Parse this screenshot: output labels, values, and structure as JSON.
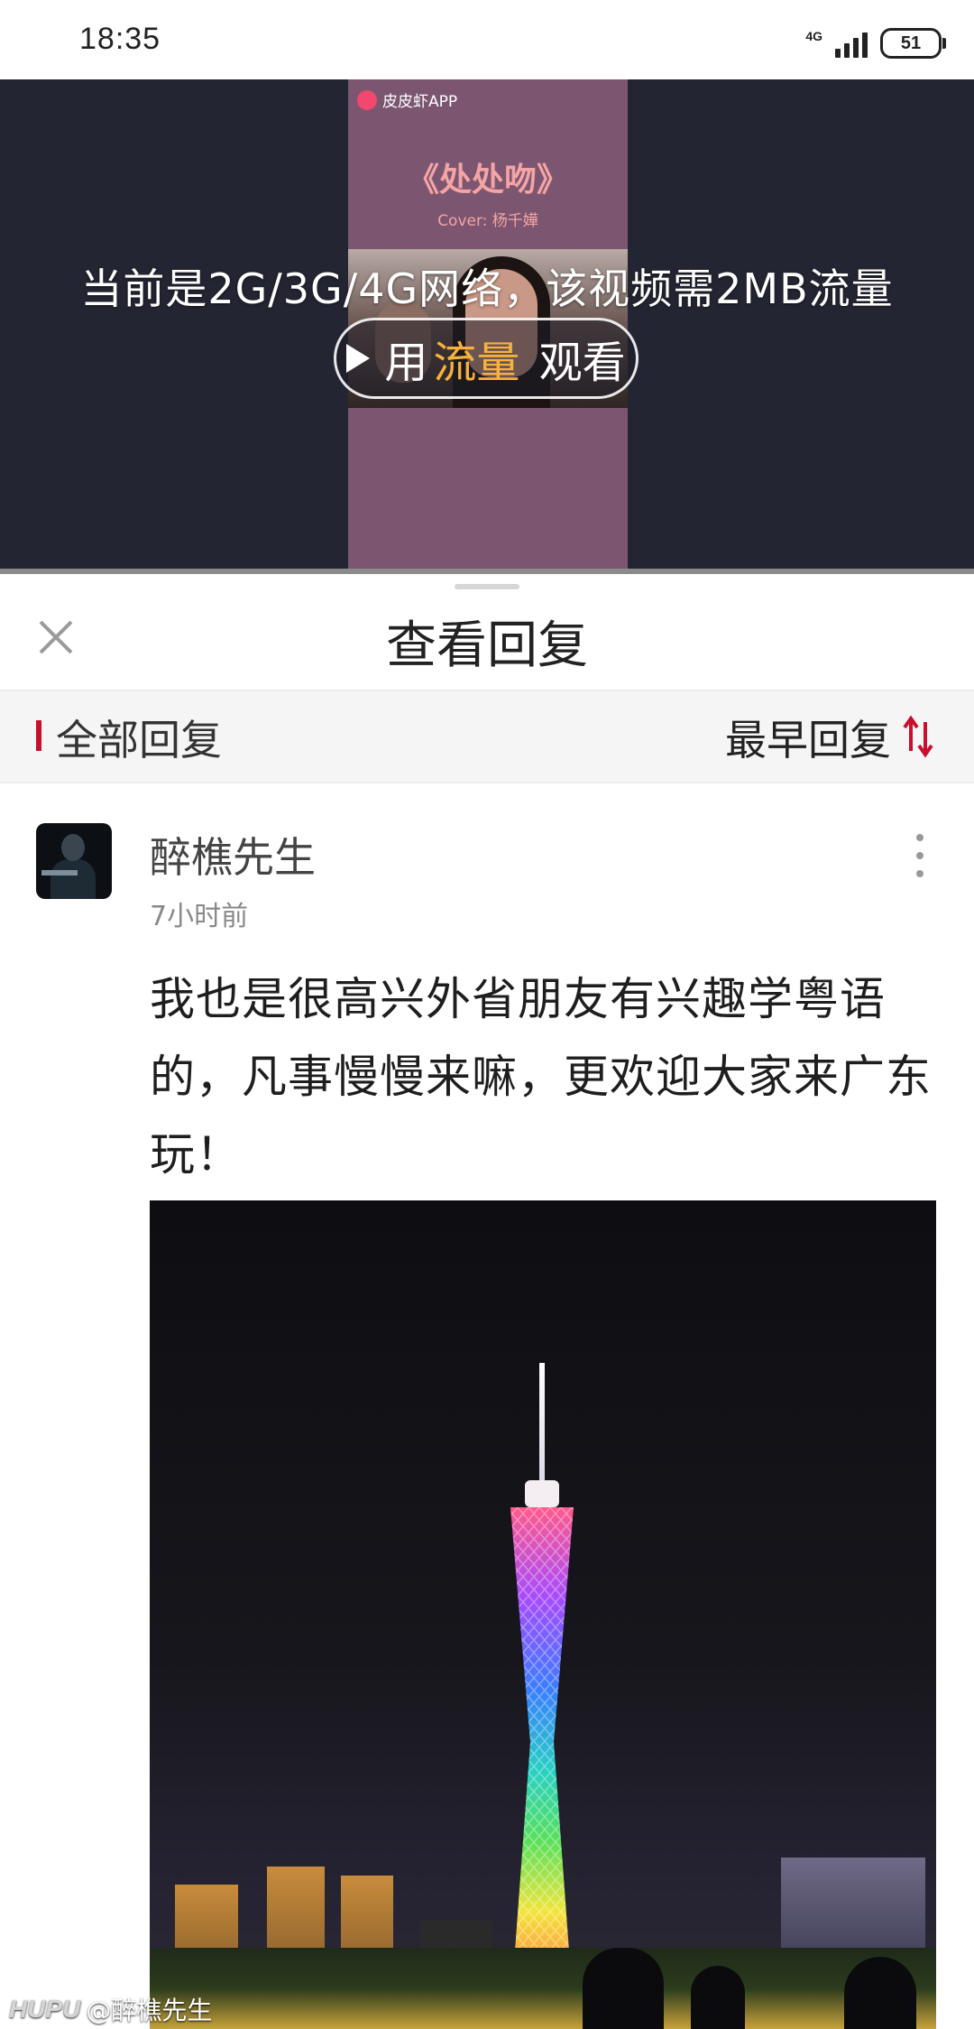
{
  "status_bar": {
    "time": "18:35",
    "network": "4G",
    "battery": "51"
  },
  "video": {
    "thumb_app": "皮皮虾APP",
    "thumb_song": "《处处吻》",
    "thumb_cover": "Cover: 杨千嬅",
    "message": "当前是2G/3G/4G网络，该视频需2MB流量",
    "play_prefix": "用",
    "play_accent": "流量",
    "play_suffix": " 观看",
    "accent_color": "#f7b23c"
  },
  "panel": {
    "title": "查看回复"
  },
  "filter": {
    "all_label": "全部回复",
    "sort_label": "最早回复",
    "indicator_color": "#c8102e"
  },
  "reply": {
    "author": "醉樵先生",
    "time": "7小时前",
    "text": "我也是很高兴外省朋友有兴趣学粤语的，凡事慢慢来嘛，更欢迎大家来广东玩！"
  },
  "watermark": {
    "logo": "HUPU",
    "user": "@醉樵先生"
  }
}
